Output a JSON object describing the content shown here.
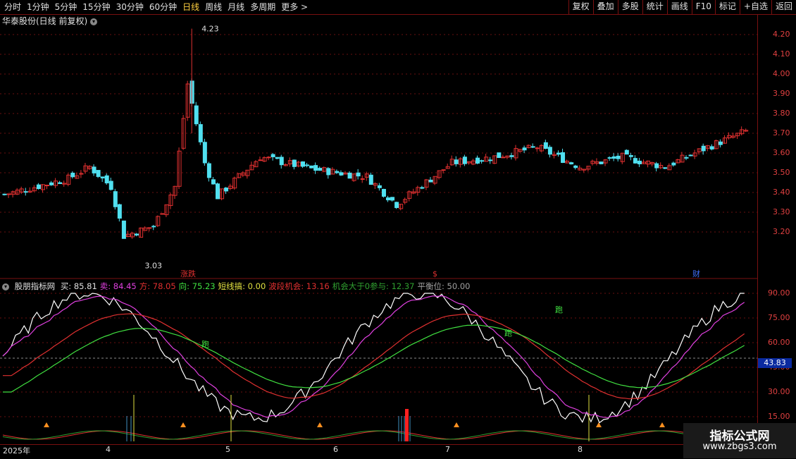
{
  "toolbar": {
    "periods": [
      "分时",
      "1分钟",
      "5分钟",
      "15分钟",
      "30分钟",
      "60分钟",
      "日线",
      "周线",
      "月线",
      "多周期",
      "更多 >"
    ],
    "active": "日线",
    "right": [
      "复权",
      "叠加",
      "多股",
      "统计",
      "画线",
      "F10",
      "标记",
      "+自选",
      "返回"
    ]
  },
  "kline": {
    "title": "华泰股份(日线 前复权)",
    "price_labels": [
      "4.20",
      "4.10",
      "4.00",
      "3.90",
      "3.80",
      "3.70",
      "3.60",
      "3.50",
      "3.40",
      "3.30",
      "3.20"
    ],
    "high_note": "4.23",
    "low_note": "3.03",
    "event_markers": [
      "涨跌",
      "$",
      "财"
    ],
    "colors": {
      "up": "#e03030",
      "down": "#50e0f0"
    }
  },
  "indicator": {
    "name": "股朋指标网",
    "values": [
      {
        "label": "买: 85.81",
        "color": "#e0e0e0"
      },
      {
        "label": "卖: 84.45",
        "color": "#e040e0"
      },
      {
        "label": "方: 78.05",
        "color": "#e03030"
      },
      {
        "label": "向: 75.23",
        "color": "#40e040"
      },
      {
        "label": "短线搞: 0.00",
        "color": "#e0e040"
      },
      {
        "label": "波段机会: 13.16",
        "color": "#e03030"
      },
      {
        "label": "机会大于0参与: 12.37",
        "color": "#30a030"
      },
      {
        "label": "平衡位: 50.00",
        "color": "#a0a0a0"
      }
    ],
    "axis_labels": [
      "90.00",
      "75.00",
      "60.00",
      "45.00",
      "30.00",
      "15.00"
    ],
    "current_value": "43.83",
    "run_labels": [
      "跑",
      "跑",
      "跑"
    ]
  },
  "dates": [
    "2025年",
    "4",
    "5",
    "6",
    "7",
    "8"
  ],
  "watermark": {
    "title": "指标公式网",
    "url": "www.zbgs3.com"
  }
}
